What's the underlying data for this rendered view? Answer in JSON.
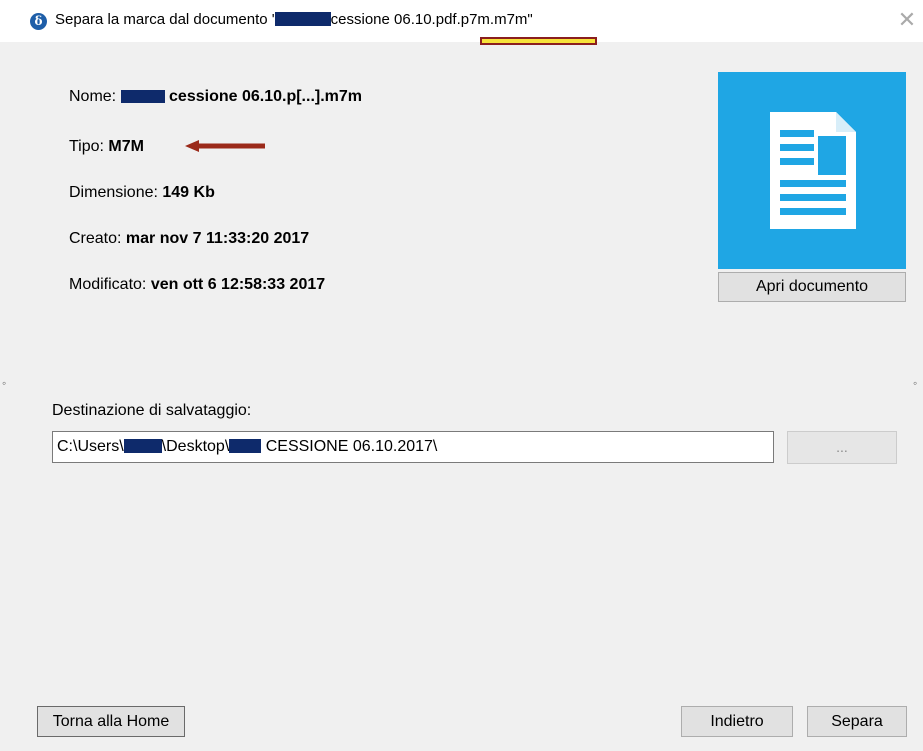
{
  "window": {
    "title_prefix": "Separa la marca dal documento '",
    "title_suffix": "cessione 06.10.pdf.p7m.m7m\"",
    "app_icon_glyph": "δ",
    "close_glyph": "✕"
  },
  "file_info": {
    "name_label": "Nome: ",
    "name_value": "cessione 06.10.p[...].m7m",
    "type_label": "Tipo: ",
    "type_value": "M7M",
    "size_label": "Dimensione: ",
    "size_value": "149 Kb",
    "created_label": "Creato: ",
    "created_value": "mar nov 7 11:33:20 2017",
    "modified_label": "Modificato: ",
    "modified_value": "ven ott 6 12:58:33 2017"
  },
  "preview": {
    "icon": "document-icon",
    "tile_color": "#1fa6e4",
    "open_button": "Apri documento"
  },
  "destination": {
    "label": "Destinazione di salvataggio:",
    "path_part1": "C:\\Users\\",
    "path_part2": "\\Desktop\\",
    "path_part3": " CESSIONE 06.10.2017\\",
    "browse_button": "..."
  },
  "footer": {
    "home_button": "Torna alla Home",
    "back_button": "Indietro",
    "split_button": "Separa"
  },
  "annotations": {
    "arrow_color": "#9b2a1a",
    "highlight_color": "#f7e33a",
    "redaction_color": "#0e2a6b"
  }
}
